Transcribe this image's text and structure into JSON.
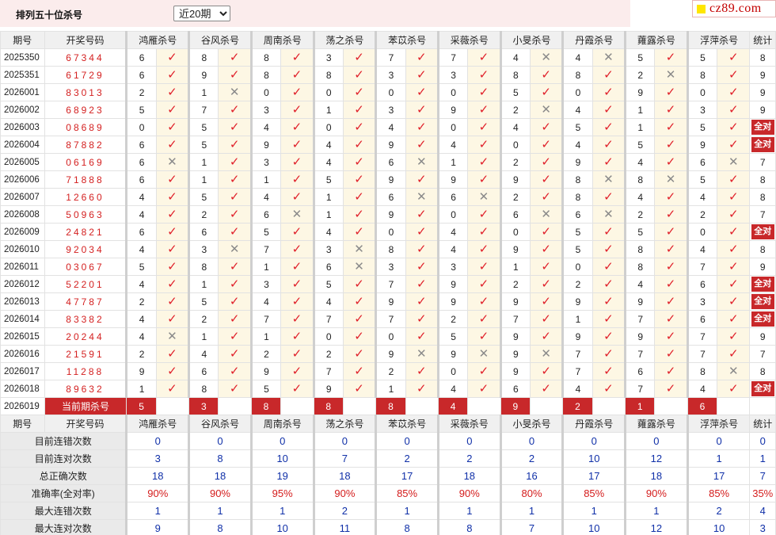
{
  "header": {
    "title": "排列五十位杀号",
    "period_select": "近20期",
    "logo_text": "cz89.com"
  },
  "colors": {
    "accent_red": "#c8282a",
    "stat_blue": "#1030a8",
    "kill_bg": "#fdf7e4"
  },
  "icons": {
    "correct": "check-mark-icon",
    "wrong": "cross-mark-icon"
  },
  "columns": {
    "issue": "期号",
    "code": "开奖号码",
    "total": "统计",
    "killers": [
      "鸿雁杀号",
      "谷风杀号",
      "周南杀号",
      "荡之杀号",
      "苯苡杀号",
      "采薇杀号",
      "小旻杀号",
      "丹霞杀号",
      "蕹露杀号",
      "浮萍杀号"
    ]
  },
  "marks": {
    "ok": "✓",
    "no": "✕",
    "all_ok": "全对"
  },
  "rows": [
    {
      "issue": "2025350",
      "code": "67344",
      "k": [
        [
          "6",
          1
        ],
        [
          "8",
          1
        ],
        [
          "8",
          1
        ],
        [
          "3",
          1
        ],
        [
          "7",
          1
        ],
        [
          "7",
          1
        ],
        [
          "4",
          0
        ],
        [
          "4",
          0
        ],
        [
          "5",
          1
        ],
        [
          "5",
          1
        ]
      ],
      "total": "8"
    },
    {
      "issue": "2025351",
      "code": "61729",
      "k": [
        [
          "6",
          1
        ],
        [
          "9",
          1
        ],
        [
          "8",
          1
        ],
        [
          "8",
          1
        ],
        [
          "3",
          1
        ],
        [
          "3",
          1
        ],
        [
          "8",
          1
        ],
        [
          "8",
          1
        ],
        [
          "2",
          0
        ],
        [
          "8",
          1
        ]
      ],
      "total": "9"
    },
    {
      "issue": "2026001",
      "code": "83013",
      "k": [
        [
          "2",
          1
        ],
        [
          "1",
          0
        ],
        [
          "0",
          1
        ],
        [
          "0",
          1
        ],
        [
          "0",
          1
        ],
        [
          "0",
          1
        ],
        [
          "5",
          1
        ],
        [
          "0",
          1
        ],
        [
          "9",
          1
        ],
        [
          "0",
          1
        ]
      ],
      "total": "9"
    },
    {
      "issue": "2026002",
      "code": "68923",
      "k": [
        [
          "5",
          1
        ],
        [
          "7",
          1
        ],
        [
          "3",
          1
        ],
        [
          "1",
          1
        ],
        [
          "3",
          1
        ],
        [
          "9",
          1
        ],
        [
          "2",
          0
        ],
        [
          "4",
          1
        ],
        [
          "1",
          1
        ],
        [
          "3",
          1
        ]
      ],
      "total": "9"
    },
    {
      "issue": "2026003",
      "code": "08689",
      "k": [
        [
          "0",
          1
        ],
        [
          "5",
          1
        ],
        [
          "4",
          1
        ],
        [
          "0",
          1
        ],
        [
          "4",
          1
        ],
        [
          "0",
          1
        ],
        [
          "4",
          1
        ],
        [
          "5",
          1
        ],
        [
          "1",
          1
        ],
        [
          "5",
          1
        ]
      ],
      "total": "全对"
    },
    {
      "issue": "2026004",
      "code": "87882",
      "k": [
        [
          "6",
          1
        ],
        [
          "5",
          1
        ],
        [
          "9",
          1
        ],
        [
          "4",
          1
        ],
        [
          "9",
          1
        ],
        [
          "4",
          1
        ],
        [
          "0",
          1
        ],
        [
          "4",
          1
        ],
        [
          "5",
          1
        ],
        [
          "9",
          1
        ]
      ],
      "total": "全对"
    },
    {
      "issue": "2026005",
      "code": "06169",
      "k": [
        [
          "6",
          0
        ],
        [
          "1",
          1
        ],
        [
          "3",
          1
        ],
        [
          "4",
          1
        ],
        [
          "6",
          0
        ],
        [
          "1",
          1
        ],
        [
          "2",
          1
        ],
        [
          "9",
          1
        ],
        [
          "4",
          1
        ],
        [
          "6",
          0
        ]
      ],
      "total": "7"
    },
    {
      "issue": "2026006",
      "code": "71888",
      "k": [
        [
          "6",
          1
        ],
        [
          "1",
          1
        ],
        [
          "1",
          1
        ],
        [
          "5",
          1
        ],
        [
          "9",
          1
        ],
        [
          "9",
          1
        ],
        [
          "9",
          1
        ],
        [
          "8",
          0
        ],
        [
          "8",
          0
        ],
        [
          "5",
          1
        ]
      ],
      "total": "8"
    },
    {
      "issue": "2026007",
      "code": "12660",
      "k": [
        [
          "4",
          1
        ],
        [
          "5",
          1
        ],
        [
          "4",
          1
        ],
        [
          "1",
          1
        ],
        [
          "6",
          0
        ],
        [
          "6",
          0
        ],
        [
          "2",
          1
        ],
        [
          "8",
          1
        ],
        [
          "4",
          1
        ],
        [
          "4",
          1
        ]
      ],
      "total": "8"
    },
    {
      "issue": "2026008",
      "code": "50963",
      "k": [
        [
          "4",
          1
        ],
        [
          "2",
          1
        ],
        [
          "6",
          0
        ],
        [
          "1",
          1
        ],
        [
          "9",
          1
        ],
        [
          "0",
          1
        ],
        [
          "6",
          0
        ],
        [
          "6",
          0
        ],
        [
          "2",
          1
        ],
        [
          "2",
          1
        ]
      ],
      "total": "7"
    },
    {
      "issue": "2026009",
      "code": "24821",
      "k": [
        [
          "6",
          1
        ],
        [
          "6",
          1
        ],
        [
          "5",
          1
        ],
        [
          "4",
          1
        ],
        [
          "0",
          1
        ],
        [
          "4",
          1
        ],
        [
          "0",
          1
        ],
        [
          "5",
          1
        ],
        [
          "5",
          1
        ],
        [
          "0",
          1
        ]
      ],
      "total": "全对"
    },
    {
      "issue": "2026010",
      "code": "92034",
      "k": [
        [
          "4",
          1
        ],
        [
          "3",
          0
        ],
        [
          "7",
          1
        ],
        [
          "3",
          0
        ],
        [
          "8",
          1
        ],
        [
          "4",
          1
        ],
        [
          "9",
          1
        ],
        [
          "5",
          1
        ],
        [
          "8",
          1
        ],
        [
          "4",
          1
        ]
      ],
      "total": "8"
    },
    {
      "issue": "2026011",
      "code": "03067",
      "k": [
        [
          "5",
          1
        ],
        [
          "8",
          1
        ],
        [
          "1",
          1
        ],
        [
          "6",
          0
        ],
        [
          "3",
          1
        ],
        [
          "3",
          1
        ],
        [
          "1",
          1
        ],
        [
          "0",
          1
        ],
        [
          "8",
          1
        ],
        [
          "7",
          1
        ]
      ],
      "total": "9"
    },
    {
      "issue": "2026012",
      "code": "52201",
      "k": [
        [
          "4",
          1
        ],
        [
          "1",
          1
        ],
        [
          "3",
          1
        ],
        [
          "5",
          1
        ],
        [
          "7",
          1
        ],
        [
          "9",
          1
        ],
        [
          "2",
          1
        ],
        [
          "2",
          1
        ],
        [
          "4",
          1
        ],
        [
          "6",
          1
        ]
      ],
      "total": "全对"
    },
    {
      "issue": "2026013",
      "code": "47787",
      "k": [
        [
          "2",
          1
        ],
        [
          "5",
          1
        ],
        [
          "4",
          1
        ],
        [
          "4",
          1
        ],
        [
          "9",
          1
        ],
        [
          "9",
          1
        ],
        [
          "9",
          1
        ],
        [
          "9",
          1
        ],
        [
          "9",
          1
        ],
        [
          "3",
          1
        ]
      ],
      "total": "全对"
    },
    {
      "issue": "2026014",
      "code": "83382",
      "k": [
        [
          "4",
          1
        ],
        [
          "2",
          1
        ],
        [
          "7",
          1
        ],
        [
          "7",
          1
        ],
        [
          "7",
          1
        ],
        [
          "2",
          1
        ],
        [
          "7",
          1
        ],
        [
          "1",
          1
        ],
        [
          "7",
          1
        ],
        [
          "6",
          1
        ]
      ],
      "total": "全对"
    },
    {
      "issue": "2026015",
      "code": "20244",
      "k": [
        [
          "4",
          0
        ],
        [
          "1",
          1
        ],
        [
          "1",
          1
        ],
        [
          "0",
          1
        ],
        [
          "0",
          1
        ],
        [
          "5",
          1
        ],
        [
          "9",
          1
        ],
        [
          "9",
          1
        ],
        [
          "9",
          1
        ],
        [
          "7",
          1
        ]
      ],
      "total": "9"
    },
    {
      "issue": "2026016",
      "code": "21591",
      "k": [
        [
          "2",
          1
        ],
        [
          "4",
          1
        ],
        [
          "2",
          1
        ],
        [
          "2",
          1
        ],
        [
          "9",
          0
        ],
        [
          "9",
          0
        ],
        [
          "9",
          0
        ],
        [
          "7",
          1
        ],
        [
          "7",
          1
        ],
        [
          "7",
          1
        ]
      ],
      "total": "7"
    },
    {
      "issue": "2026017",
      "code": "11288",
      "k": [
        [
          "9",
          1
        ],
        [
          "6",
          1
        ],
        [
          "9",
          1
        ],
        [
          "7",
          1
        ],
        [
          "2",
          1
        ],
        [
          "0",
          1
        ],
        [
          "9",
          1
        ],
        [
          "7",
          1
        ],
        [
          "6",
          1
        ],
        [
          "8",
          0
        ]
      ],
      "total": "8"
    },
    {
      "issue": "2026018",
      "code": "89632",
      "k": [
        [
          "1",
          1
        ],
        [
          "8",
          1
        ],
        [
          "5",
          1
        ],
        [
          "9",
          1
        ],
        [
          "1",
          1
        ],
        [
          "4",
          1
        ],
        [
          "6",
          1
        ],
        [
          "4",
          1
        ],
        [
          "7",
          1
        ],
        [
          "4",
          1
        ]
      ],
      "total": "全对"
    }
  ],
  "current": {
    "issue": "2026019",
    "label": "当前期杀号",
    "values": [
      "5",
      "3",
      "8",
      "8",
      "8",
      "4",
      "9",
      "2",
      "1",
      "6"
    ]
  },
  "stats": [
    {
      "label": "目前连错次数",
      "values": [
        "0",
        "0",
        "0",
        "0",
        "0",
        "0",
        "0",
        "0",
        "0",
        "0"
      ],
      "total": "0",
      "color": "blue"
    },
    {
      "label": "目前连对次数",
      "values": [
        "3",
        "8",
        "10",
        "7",
        "2",
        "2",
        "2",
        "10",
        "12",
        "1"
      ],
      "total": "1",
      "color": "blue"
    },
    {
      "label": "总正确次数",
      "values": [
        "18",
        "18",
        "19",
        "18",
        "17",
        "18",
        "16",
        "17",
        "18",
        "17"
      ],
      "total": "7",
      "color": "blue"
    },
    {
      "label": "准确率(全对率)",
      "values": [
        "90%",
        "90%",
        "95%",
        "90%",
        "85%",
        "90%",
        "80%",
        "85%",
        "90%",
        "85%"
      ],
      "total": "35%",
      "color": "red"
    },
    {
      "label": "最大连错次数",
      "values": [
        "1",
        "1",
        "1",
        "2",
        "1",
        "1",
        "1",
        "1",
        "1",
        "2"
      ],
      "total": "4",
      "color": "blue"
    },
    {
      "label": "最大连对次数",
      "values": [
        "9",
        "8",
        "10",
        "11",
        "8",
        "8",
        "7",
        "10",
        "12",
        "10"
      ],
      "total": "3",
      "color": "blue"
    }
  ]
}
